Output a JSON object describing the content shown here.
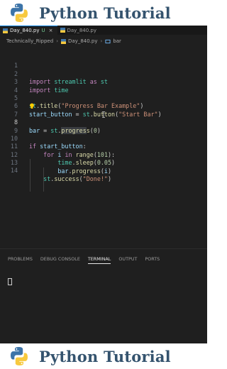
{
  "banner": {
    "title": "Python Tutorial"
  },
  "editor": {
    "tabs": [
      {
        "label": "Day_840.py",
        "modified": "U",
        "close": "×",
        "active": true
      },
      {
        "label": "Day_840.py",
        "active": false
      }
    ],
    "breadcrumbs": {
      "folder": "Technically_Ripped",
      "file": "Day_840.py",
      "symbol": "bar",
      "separator": "›"
    },
    "current_line": 8
  },
  "code_lines": [
    {
      "n": "1"
    },
    {
      "n": "2"
    },
    {
      "n": "3"
    },
    {
      "n": "4"
    },
    {
      "n": "5"
    },
    {
      "n": "6"
    },
    {
      "n": "7"
    },
    {
      "n": "8"
    },
    {
      "n": "9"
    },
    {
      "n": "10"
    },
    {
      "n": "11"
    },
    {
      "n": "12"
    },
    {
      "n": "13"
    },
    {
      "n": "14"
    }
  ],
  "code": {
    "l2": {
      "k1": "import",
      "m": "streamlit",
      "k2": "as",
      "a": "st"
    },
    "l3": {
      "k1": "import",
      "m": "time"
    },
    "l5": {
      "o": "st",
      "f": "title",
      "s": "\"Progress Bar Example\""
    },
    "l6": {
      "v": "start_button",
      "eq": " = ",
      "o": "st",
      "f": "button",
      "s": "\"Start Bar\""
    },
    "l8": {
      "v": "bar",
      "eq": " = ",
      "o": "st",
      "f1": "progre",
      "f2": "s",
      "f3": "s",
      "n": "0"
    },
    "l10": {
      "k": "if",
      "v": "start_button"
    },
    "l11": {
      "k1": "for",
      "v": "i",
      "k2": "in",
      "f": "range",
      "n": "101"
    },
    "l12": {
      "o": "time",
      "f": "sleep",
      "n": "0.05"
    },
    "l13": {
      "o": "bar",
      "f": "progress",
      "v": "i"
    },
    "l14": {
      "o": "st",
      "f": "success",
      "s": "\"Done!\""
    }
  },
  "panel": {
    "tabs": [
      "PROBLEMS",
      "DEBUG CONSOLE",
      "TERMINAL",
      "OUTPUT",
      "PORTS"
    ],
    "active_tab": "TERMINAL"
  },
  "colors": {
    "accent": "#0078d4",
    "editor_bg": "#1f1f1f",
    "banner_text": "#34536e"
  }
}
